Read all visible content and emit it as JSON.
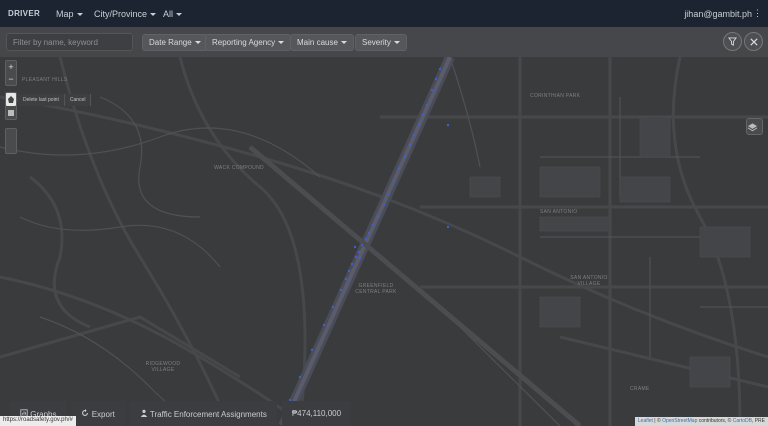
{
  "navbar": {
    "brand": "DRIVER",
    "items": [
      {
        "label": "Map"
      },
      {
        "label": "City/Province"
      },
      {
        "label": "All"
      }
    ],
    "user": "jihan@gambit.ph",
    "menu_glyph": "⋮"
  },
  "filters": {
    "search_placeholder": "Filter by name, keyword",
    "buttons": [
      {
        "label": "Date Range"
      },
      {
        "label": "Reporting Agency"
      },
      {
        "label": "Main cause"
      },
      {
        "label": "Severity"
      }
    ],
    "filter_icon": "filter-icon",
    "close_icon": "close-icon"
  },
  "map": {
    "zoom_in": "+",
    "zoom_out": "−",
    "draw_tooltip": {
      "delete_last_point": "Delete last point",
      "cancel": "Cancel"
    },
    "labels": [
      {
        "text": "Pleasant Hills"
      },
      {
        "text": "Corinthian Park"
      },
      {
        "text": "Wack Compound"
      },
      {
        "text": "San Antonio"
      },
      {
        "text": "Greenfield Central Park"
      },
      {
        "text": "San Antonio Village"
      },
      {
        "text": "Ridgewood Village"
      },
      {
        "text": "Crame"
      }
    ]
  },
  "bottom_tabs": [
    {
      "label": "Graphs",
      "icon": "chart-icon"
    },
    {
      "label": "Export",
      "icon": "refresh-icon"
    },
    {
      "label": "Traffic Enforcement Assignments",
      "icon": "person-icon"
    },
    {
      "label": "₱474,110,000",
      "icon": ""
    }
  ],
  "status_url": "https://roadsafety.gov.ph/#",
  "attribution": {
    "leaflet": "Leaflet",
    "sep1": " | © ",
    "osm": "OpenStreetMap",
    "mid": " contributors, © ",
    "cartodb": "CartoDB",
    "tail": ", PRE"
  }
}
